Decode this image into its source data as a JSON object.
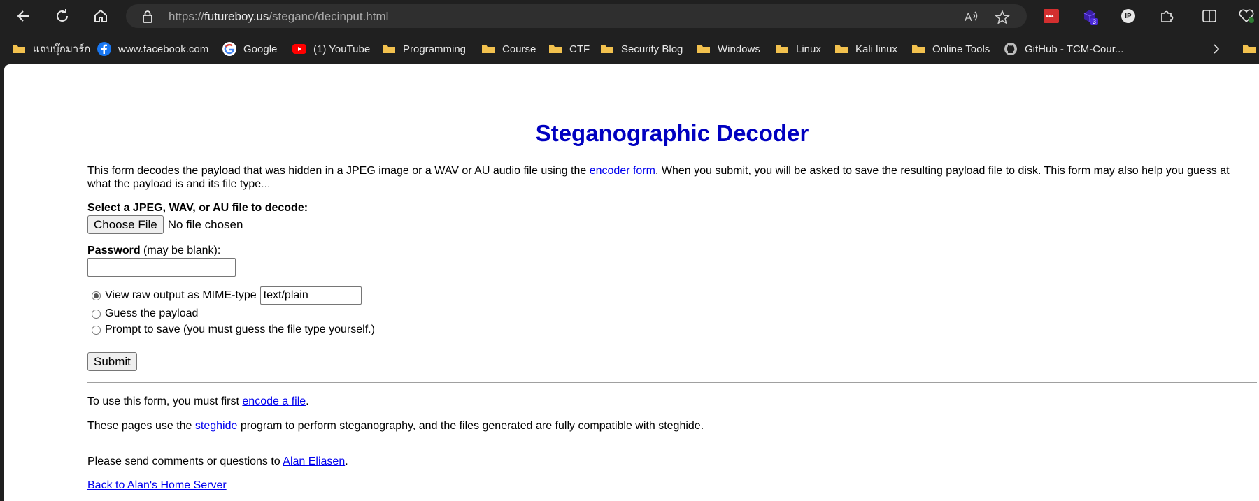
{
  "browser": {
    "url_scheme": "https://",
    "url_host": "futureboy.us",
    "url_path": "/stegano/decinput.html",
    "ext_badge": "3",
    "ext_ip_label": "IP"
  },
  "bookmarks": [
    {
      "label": "แถบบุ๊กมาร์ก",
      "icon": "folder-icon"
    },
    {
      "label": "www.facebook.com",
      "icon": "facebook-icon"
    },
    {
      "label": "Google",
      "icon": "google-icon"
    },
    {
      "label": "(1) YouTube",
      "icon": "youtube-icon"
    },
    {
      "label": "Programming",
      "icon": "folder-icon"
    },
    {
      "label": "Course",
      "icon": "folder-icon"
    },
    {
      "label": "CTF",
      "icon": "folder-icon"
    },
    {
      "label": "Security Blog",
      "icon": "folder-icon"
    },
    {
      "label": "Windows",
      "icon": "folder-icon"
    },
    {
      "label": "Linux",
      "icon": "folder-icon"
    },
    {
      "label": "Kali linux",
      "icon": "folder-icon"
    },
    {
      "label": "Online Tools",
      "icon": "folder-icon"
    },
    {
      "label": "GitHub - TCM-Cour...",
      "icon": "github-icon"
    }
  ],
  "page": {
    "title": "Steganographic Decoder",
    "intro_before_link": "This form decodes the payload that was hidden in a JPEG image or a WAV or AU audio file using the ",
    "intro_link": "encoder form",
    "intro_after_link": ". When you submit, you will be asked to save the resulting payload file to disk. This form may also help you guess at what the payload is and its file type",
    "intro_ellipsis": "...",
    "file_label": "Select a JPEG, WAV, or AU file to decode:",
    "choose_file_button": "Choose File",
    "no_file_text": "No file chosen",
    "password_label": "Password",
    "password_note": " (may be blank):",
    "password_value": "",
    "radio_raw_label": "View raw output as MIME-type",
    "mime_value": "text/plain",
    "radio_guess_label": "Guess the payload",
    "radio_prompt_label": "Prompt to save (you must guess the file type yourself.)",
    "selected_option": "raw",
    "submit_button": "Submit",
    "encode_before": "To use this form, you must first ",
    "encode_link": "encode a file",
    "encode_after": ".",
    "steghide_before": "These pages use the ",
    "steghide_link": "steghide",
    "steghide_after": " program to perform steganography, and the files generated are fully compatible with steghide.",
    "comments_before": "Please send comments or questions to ",
    "comments_link": "Alan Eliasen",
    "comments_after": ".",
    "home_link": "Back to Alan's Home Server"
  },
  "colors": {
    "title": "#0000c0",
    "link": "#0000ee",
    "browser_bg": "#202020"
  }
}
